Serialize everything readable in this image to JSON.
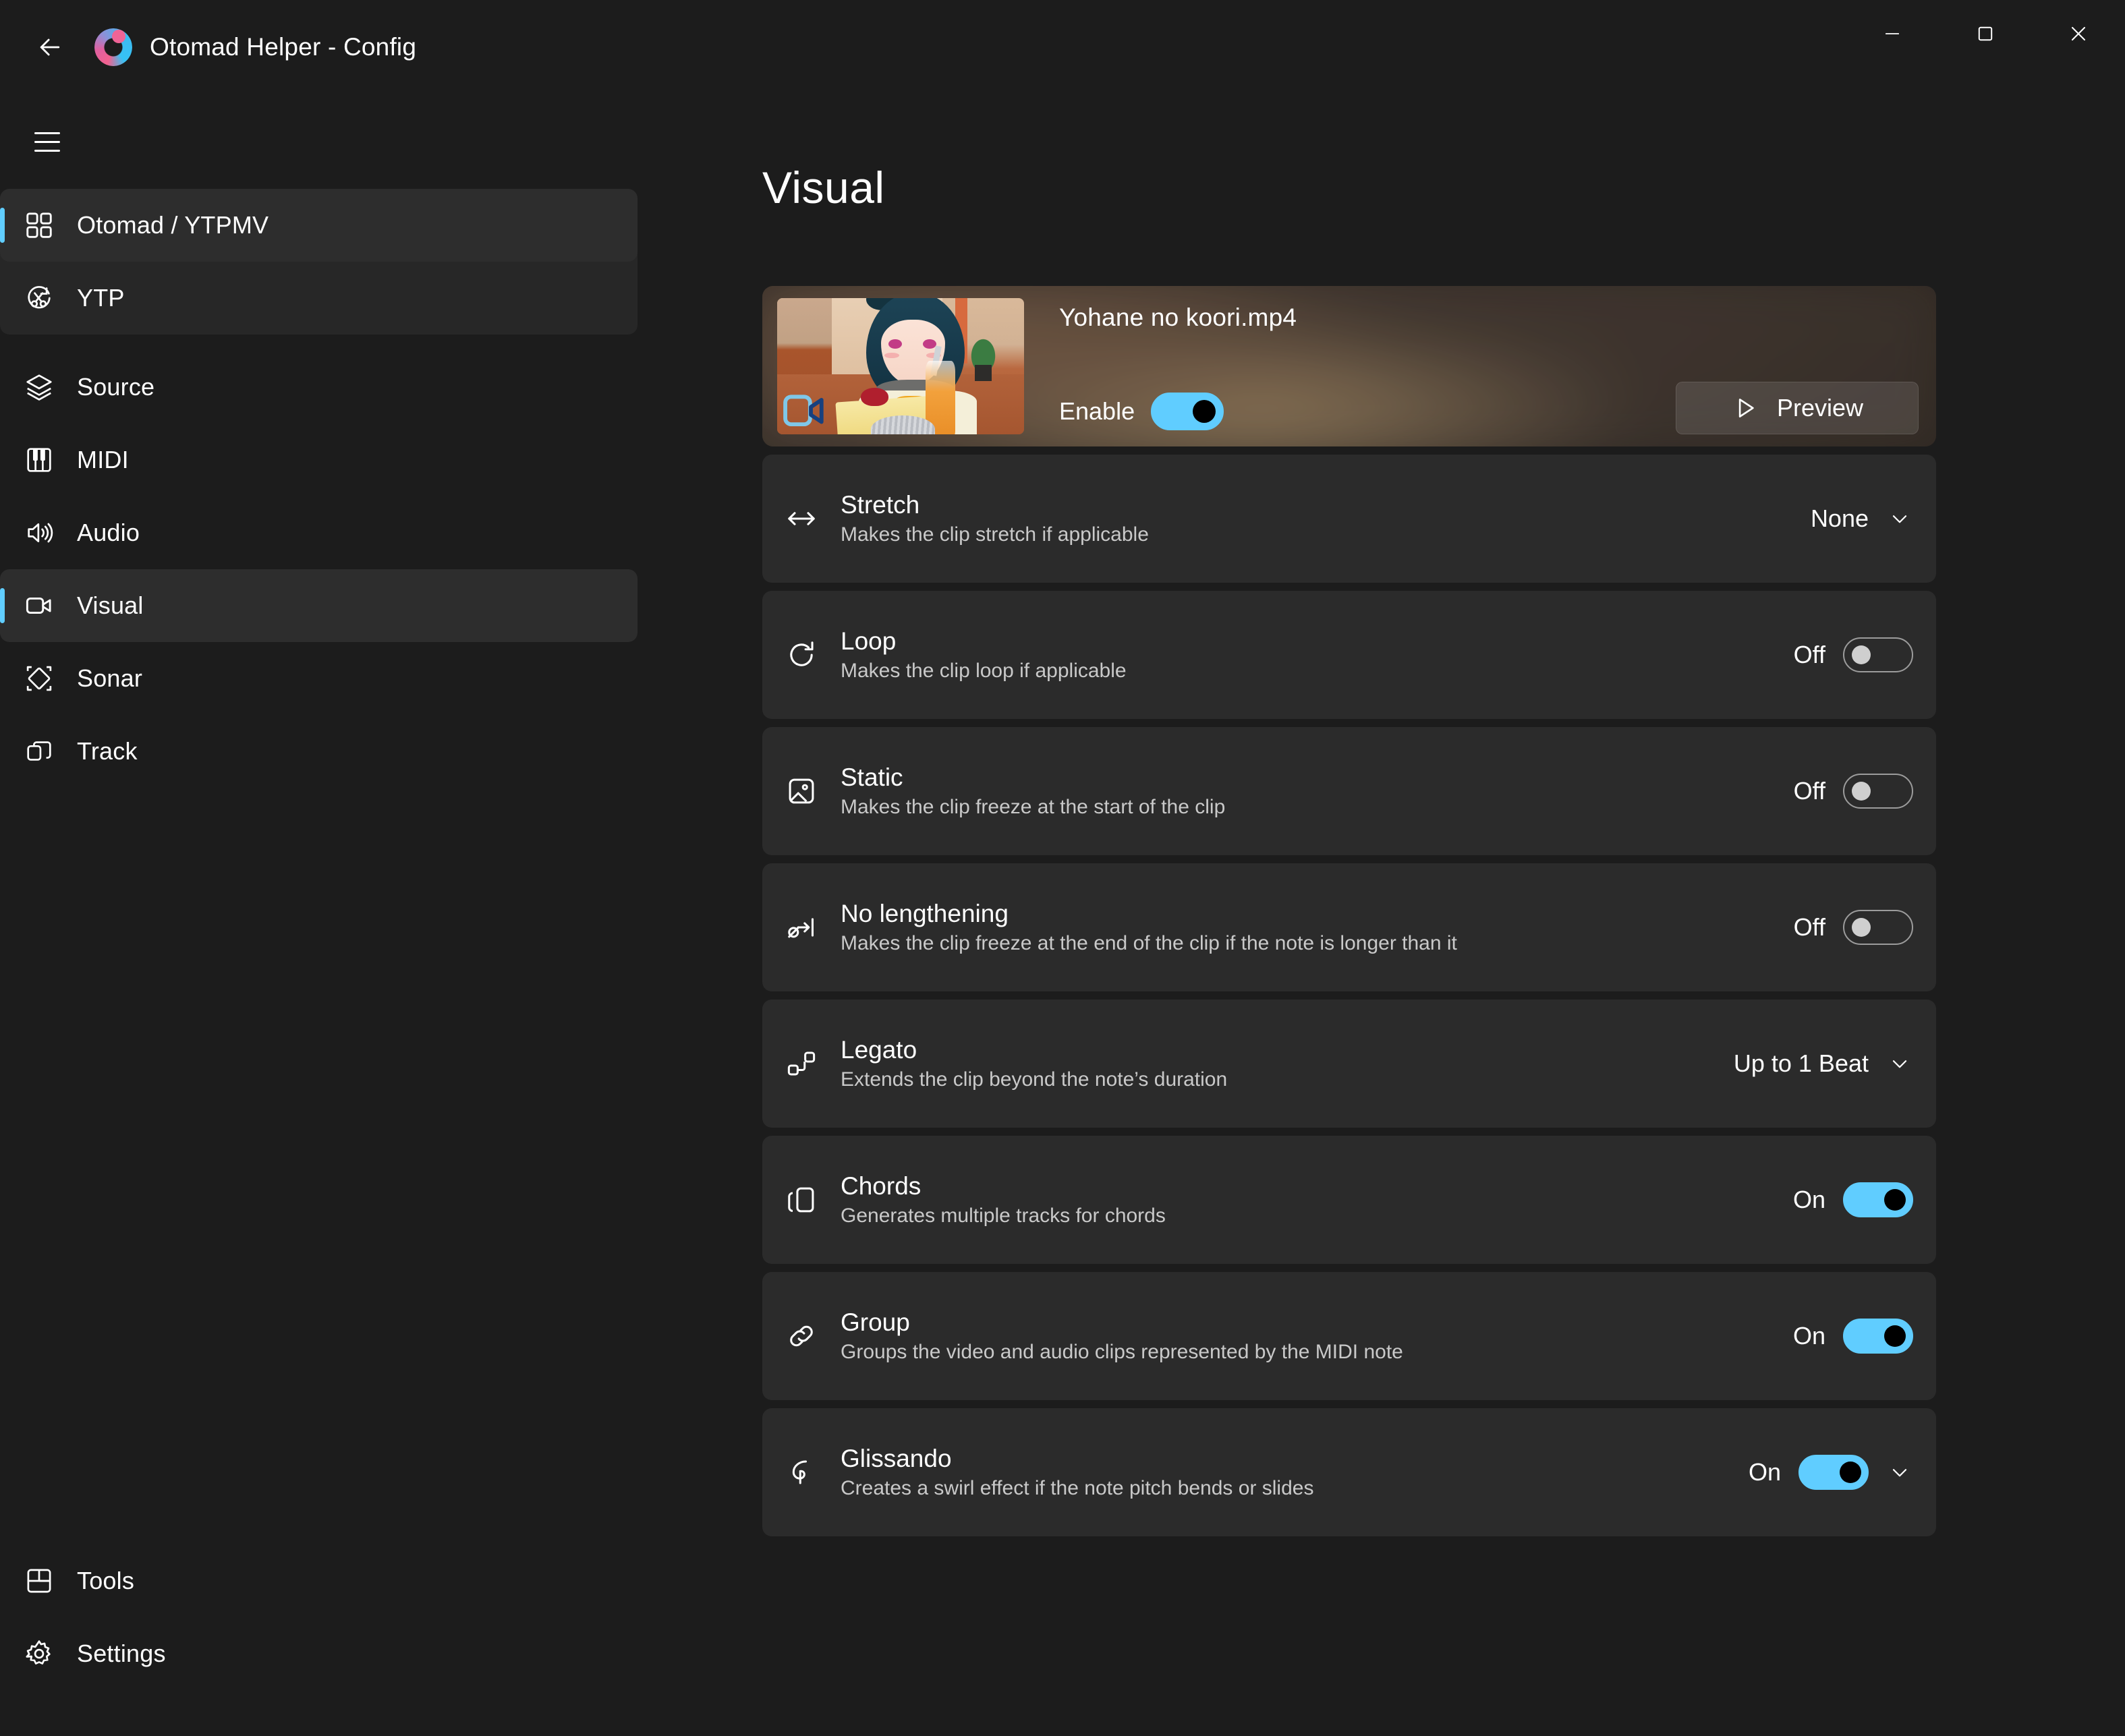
{
  "window": {
    "title": "Otomad Helper - Config",
    "back_icon": "arrow-left-icon",
    "logo_icon": "otomad-helper-logo",
    "minimize_icon": "minimize-icon",
    "maximize_icon": "maximize-icon",
    "close_icon": "close-icon",
    "hamburger_icon": "hamburger-menu-icon"
  },
  "colors": {
    "accent": "#60cdff",
    "app_background": "#1c1c1c",
    "card_background": "#2b2b2b",
    "sidebar_group_background": "#272727",
    "selected_item_background": "#2d2d2d",
    "text_primary": "#ffffff",
    "text_secondary": "#c9c9c9",
    "toggle_off_border": "#9c9c9c",
    "toggle_off_knob": "#cfcfcf"
  },
  "sidebar": {
    "items": [
      {
        "label": "Otomad / YTPMV",
        "icon": "grid-apps-icon",
        "selected": true,
        "grouped": true
      },
      {
        "label": "YTP",
        "icon": "scissors-refresh-icon",
        "selected": false,
        "grouped": true
      },
      {
        "label": "Source",
        "icon": "layers-icon",
        "selected": false,
        "grouped": false
      },
      {
        "label": "MIDI",
        "icon": "piano-keys-icon",
        "selected": false,
        "grouped": false
      },
      {
        "label": "Audio",
        "icon": "speaker-waves-icon",
        "selected": false,
        "grouped": false
      },
      {
        "label": "Visual",
        "icon": "video-camera-icon",
        "selected": true,
        "grouped": false
      },
      {
        "label": "Sonar",
        "icon": "diamond-crop-icon",
        "selected": false,
        "grouped": false
      },
      {
        "label": "Track",
        "icon": "copy-layers-icon",
        "selected": false,
        "grouped": false
      }
    ],
    "bottom_items": [
      {
        "label": "Tools",
        "icon": "dashboard-tools-icon"
      },
      {
        "label": "Settings",
        "icon": "gear-icon"
      }
    ]
  },
  "main": {
    "page_title": "Visual",
    "media": {
      "file_name": "Yohane no koori.mp4",
      "thumbnail_badge_icon": "video-camera-icon",
      "enable_label": "Enable",
      "enable_state": "on",
      "preview_label": "Preview",
      "preview_icon": "play-triangle-icon"
    },
    "settings": [
      {
        "icon": "arrows-horizontal-icon",
        "title": "Stretch",
        "description": "Makes the clip stretch if applicable",
        "control": "dropdown",
        "value": "None",
        "chevron_icon": "chevron-down-icon"
      },
      {
        "icon": "loop-refresh-icon",
        "title": "Loop",
        "description": "Makes the clip loop if applicable",
        "control": "toggle",
        "value": "Off",
        "state": "off"
      },
      {
        "icon": "image-picture-icon",
        "title": "Static",
        "description": "Makes the clip freeze at the start of the clip",
        "control": "toggle",
        "value": "Off",
        "state": "off"
      },
      {
        "icon": "no-lengthening-icon",
        "title": "No lengthening",
        "description": "Makes the clip freeze at the end of the clip if the note is longer than it",
        "control": "toggle",
        "value": "Off",
        "state": "off"
      },
      {
        "icon": "legato-notes-icon",
        "title": "Legato",
        "description": "Extends the clip beyond the note’s duration",
        "control": "dropdown",
        "value": "Up to 1 Beat",
        "chevron_icon": "chevron-down-icon"
      },
      {
        "icon": "chords-copy-icon",
        "title": "Chords",
        "description": "Generates multiple tracks for chords",
        "control": "toggle",
        "value": "On",
        "state": "on"
      },
      {
        "icon": "link-group-icon",
        "title": "Group",
        "description": "Groups the video and audio clips represented by the MIDI note",
        "control": "toggle",
        "value": "On",
        "state": "on"
      },
      {
        "icon": "glissando-swirl-icon",
        "title": "Glissando",
        "description": "Creates a swirl effect if the note pitch bends or slides",
        "control": "toggle-expand",
        "value": "On",
        "state": "on",
        "chevron_icon": "chevron-down-icon"
      }
    ]
  }
}
